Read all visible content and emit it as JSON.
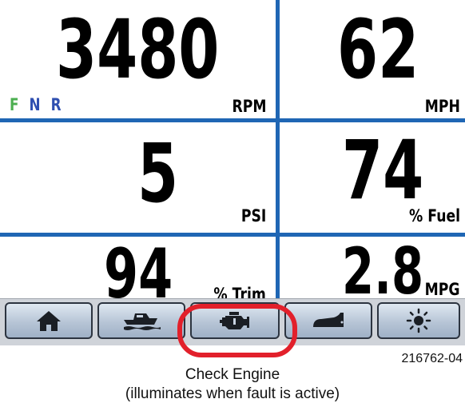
{
  "gauges": {
    "rpm": {
      "value": "3480",
      "unit": "RPM"
    },
    "speed": {
      "value": "62",
      "unit": "MPH"
    },
    "pressure": {
      "value": "5",
      "unit": "PSI"
    },
    "fuel": {
      "value": "74",
      "unit": "% Fuel"
    },
    "trim": {
      "value": "94",
      "unit": "% Trim"
    },
    "economy": {
      "value": "2.8",
      "unit": "MPG"
    }
  },
  "gear_indicator": [
    {
      "letter": "F",
      "color": "#4caf50"
    },
    {
      "letter": "N",
      "color": "#2f4fb0"
    },
    {
      "letter": "R",
      "color": "#2f4fb0"
    }
  ],
  "nav_buttons": [
    {
      "icon": "home-icon"
    },
    {
      "icon": "boat-icon"
    },
    {
      "icon": "engine-icon"
    },
    {
      "icon": "fuel-tank-icon"
    },
    {
      "icon": "brightness-icon"
    }
  ],
  "figure_id": "216762-04",
  "caption": {
    "line1": "Check Engine",
    "line2": "(illuminates when fault is active)"
  },
  "colors": {
    "divider": "#1f66b4",
    "highlight": "#e2202b",
    "nav_bar": "#cfd3d9"
  }
}
